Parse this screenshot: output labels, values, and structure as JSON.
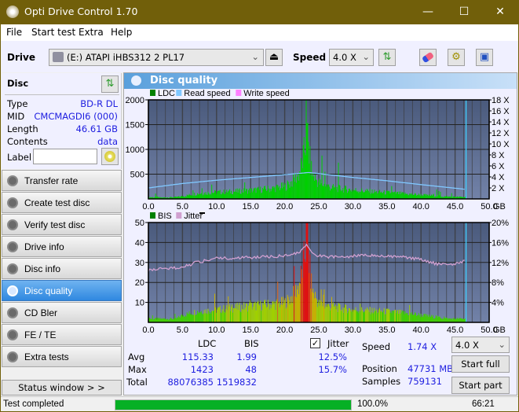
{
  "window": {
    "title": "Opti Drive Control 1.70",
    "minimize": "—",
    "maximize": "☐",
    "close": "✕"
  },
  "menu": [
    "File",
    "Start test",
    "Extra",
    "Help"
  ],
  "toolbar": {
    "drive_label": "Drive",
    "drive_value": "(E:)  ATAPI iHBS312  2 PL17",
    "speed_label": "Speed",
    "speed_value": "4.0 X"
  },
  "disc": {
    "header": "Disc",
    "rows": [
      {
        "key": "Type",
        "value": "BD-R DL"
      },
      {
        "key": "MID",
        "value": "CMCMAGDI6 (000)"
      },
      {
        "key": "Length",
        "value": "46.61 GB"
      },
      {
        "key": "Contents",
        "value": "data"
      }
    ],
    "label_key": "Label",
    "label_value": ""
  },
  "nav": [
    {
      "label": "Transfer rate",
      "active": false
    },
    {
      "label": "Create test disc",
      "active": false
    },
    {
      "label": "Verify test disc",
      "active": false
    },
    {
      "label": "Drive info",
      "active": false
    },
    {
      "label": "Disc info",
      "active": false
    },
    {
      "label": "Disc quality",
      "active": true
    },
    {
      "label": "CD Bler",
      "active": false
    },
    {
      "label": "FE / TE",
      "active": false
    },
    {
      "label": "Extra tests",
      "active": false
    }
  ],
  "status_window_button": "Status window > >",
  "panel_title": "Disc quality",
  "chart_data": [
    {
      "type": "bar",
      "legend": [
        "LDC",
        "Read speed",
        "Write speed"
      ],
      "legend_colors": [
        "#008000",
        "#80c8ff",
        "#ff80ff"
      ],
      "xlabel": "GB",
      "x_ticks": [
        "0.0",
        "5.0",
        "10.0",
        "15.0",
        "20.0",
        "25.0",
        "30.0",
        "35.0",
        "40.0",
        "45.0",
        "50.0"
      ],
      "xlim": [
        0,
        50
      ],
      "ylim": [
        0,
        2000
      ],
      "y_ticks": [
        "500",
        "1000",
        "1500",
        "2000"
      ],
      "y2_ticks": [
        "2 X",
        "4 X",
        "6 X",
        "8 X",
        "10 X",
        "12 X",
        "14 X",
        "16 X",
        "18 X"
      ],
      "y2lim": [
        0,
        18
      ],
      "end_position_gb": 46.61,
      "ldc_profile": {
        "x": [
          0,
          2,
          4,
          5,
          7,
          10,
          13,
          15,
          18,
          20,
          21,
          22,
          22.5,
          23,
          23.3,
          23.6,
          24,
          25,
          27,
          30,
          33,
          35,
          38,
          40,
          42,
          44,
          46.6
        ],
        "y": [
          40,
          30,
          40,
          60,
          120,
          150,
          170,
          190,
          230,
          280,
          380,
          550,
          800,
          1200,
          1423,
          900,
          550,
          350,
          250,
          200,
          160,
          140,
          110,
          90,
          70,
          50,
          40
        ]
      },
      "read_speed": {
        "x": [
          0,
          5,
          10,
          15,
          20,
          23.5,
          25,
          30,
          35,
          40,
          46.6
        ],
        "y": [
          2.0,
          2.8,
          3.4,
          3.9,
          4.4,
          4.8,
          4.6,
          3.9,
          3.3,
          2.6,
          1.74
        ]
      }
    },
    {
      "type": "bar",
      "legend": [
        "BIS",
        "Jitter"
      ],
      "legend_colors": [
        "#008000",
        "#d0a0d0"
      ],
      "xlabel": "GB",
      "x_ticks": [
        "0.0",
        "5.0",
        "10.0",
        "15.0",
        "20.0",
        "25.0",
        "30.0",
        "35.0",
        "40.0",
        "45.0",
        "50.0"
      ],
      "xlim": [
        0,
        50
      ],
      "ylim": [
        0,
        50
      ],
      "y_ticks": [
        "10",
        "20",
        "30",
        "40",
        "50"
      ],
      "y2_ticks": [
        "4%",
        "8%",
        "12%",
        "16%",
        "20%"
      ],
      "y2lim": [
        0,
        20
      ],
      "bis_profile": {
        "x": [
          0,
          4,
          5,
          7,
          10,
          15,
          18,
          20,
          21,
          22,
          22.5,
          23,
          23.3,
          23.6,
          24,
          25,
          28,
          30,
          35,
          38,
          40,
          42,
          44,
          46.6
        ],
        "y": [
          2,
          2,
          4,
          6,
          7,
          9,
          10,
          11,
          14,
          20,
          28,
          40,
          48,
          30,
          18,
          10,
          8,
          7,
          6,
          5,
          4,
          3,
          2,
          2
        ]
      },
      "jitter": {
        "x": [
          0,
          3,
          5,
          7,
          10,
          15,
          20,
          22,
          23.3,
          24,
          25,
          28,
          32,
          35,
          38,
          40,
          42,
          44,
          45,
          46.6
        ],
        "y": [
          10.5,
          10.8,
          11.0,
          12.0,
          12.8,
          13.0,
          13.3,
          14.0,
          15.5,
          14.0,
          13.3,
          13.0,
          13.5,
          13.3,
          13.0,
          12.6,
          11.8,
          11.4,
          11.7,
          12.5
        ]
      }
    }
  ],
  "stats": {
    "col_ldc": "LDC",
    "col_bis": "BIS",
    "jitter_label": "Jitter",
    "jitter_checked": true,
    "rows": [
      {
        "label": "Avg",
        "ldc": "115.33",
        "bis": "1.99",
        "jitter": "12.5%"
      },
      {
        "label": "Max",
        "ldc": "1423",
        "bis": "48",
        "jitter": "15.7%"
      },
      {
        "label": "Total",
        "ldc": "88076385",
        "bis": "1519832",
        "jitter": ""
      }
    ],
    "speed_label": "Speed",
    "speed_value": "1.74 X",
    "position_label": "Position",
    "position_value": "47731 MB",
    "samples_label": "Samples",
    "samples_value": "759131",
    "speed_select": "4.0 X",
    "start_full": "Start full",
    "start_part": "Start part"
  },
  "status": {
    "text": "Test completed",
    "progress": 1.0,
    "progress_text": "100.0%",
    "elapsed": "66:21"
  }
}
